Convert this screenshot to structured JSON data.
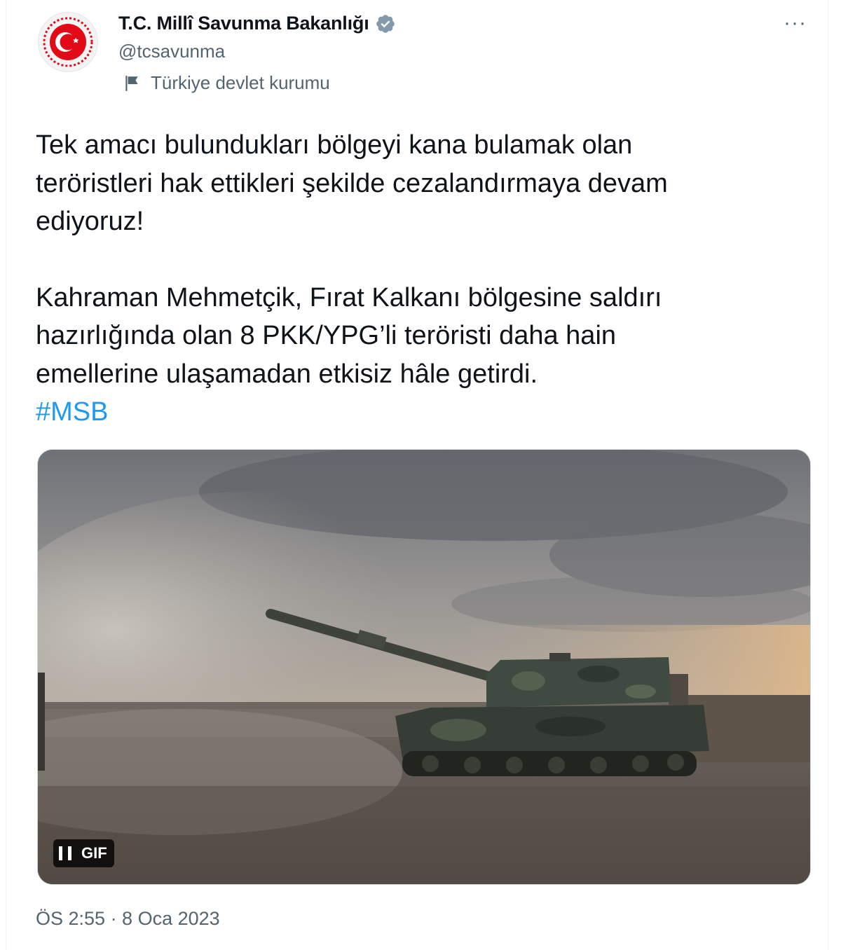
{
  "account": {
    "display_name": "T.C. Millî Savunma Bakanlığı",
    "handle": "@tcsavunma",
    "verified": true,
    "label": "Türkiye devlet kurumu",
    "label_icon": "flag-icon",
    "avatar_icon": "crescent-star-emblem"
  },
  "menu": {
    "more_label": "···"
  },
  "tweet": {
    "paragraph1": "Tek amacı bulundukları bölgeyi kana bulamak olan\nteröristleri hak ettikleri şekilde cezalandırmaya devam\nediyoruz!",
    "paragraph2": "Kahraman Mehmetçik, Fırat Kalkanı bölgesine saldırı\nhazırlığında olan 8 PKK/YPG’li teröristi daha hain\nemellerine ulaşamadan etkisiz hâle getirdi.",
    "hashtag": "#MSB"
  },
  "media": {
    "type": "gif",
    "badge_label": "GIF",
    "playback_icon": "pause-icon"
  },
  "timestamp": "ÖS 2:55 · 8 Oca 2023",
  "colors": {
    "text": "#0f1419",
    "secondary": "#536471",
    "link": "#1d9bf0",
    "emblem_red": "#e30a17"
  }
}
